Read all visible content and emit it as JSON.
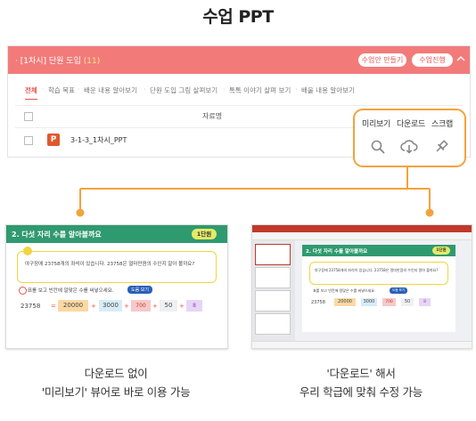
{
  "title": "수업 PPT",
  "panel": {
    "header_title": "· [1차시] 단원 도입",
    "header_count": "(11)",
    "btn_make": "수업안 만들기",
    "btn_run": "수업진행",
    "tabs": [
      "전체",
      "학습 목표",
      "배운 내용 알아보기",
      "단원 도입 그림 살펴보기",
      "톡톡 이야기 살펴 보기",
      "배울 내용 알아보기"
    ],
    "column_label": "자료명",
    "file_badge": "P",
    "file_name": "3-1-3_1차시_PPT"
  },
  "callout": {
    "preview": "미리보기",
    "download": "다운로드",
    "scrap": "스크랩"
  },
  "slide": {
    "title": "2. 다섯 자리 수를 알아볼까요",
    "unit": "1단원",
    "question": "야구장에 23758개의 좌석이 있습니다. 23758은 얼마만큼의 수인지 알아 볼까요?",
    "task": "표를 보고 빈칸에 알맞은 수를 써넣으세요.",
    "hint": "도움 보기",
    "equation": [
      "23758",
      "20000",
      "3000",
      "700",
      "50",
      "8"
    ]
  },
  "captions": {
    "left_line1": "다운로드 없이",
    "left_line2": "'미리보기' 뷰어로 바로 이용 가능",
    "right_line1": "'다운로드' 해서",
    "right_line2": "우리 학급에 맞춰 수정 가능"
  },
  "colors": {
    "header": "#f27b7a",
    "accent_orange": "#f4a23c",
    "slide_green": "#2f9a6f",
    "ppt_red": "#e0582d"
  }
}
